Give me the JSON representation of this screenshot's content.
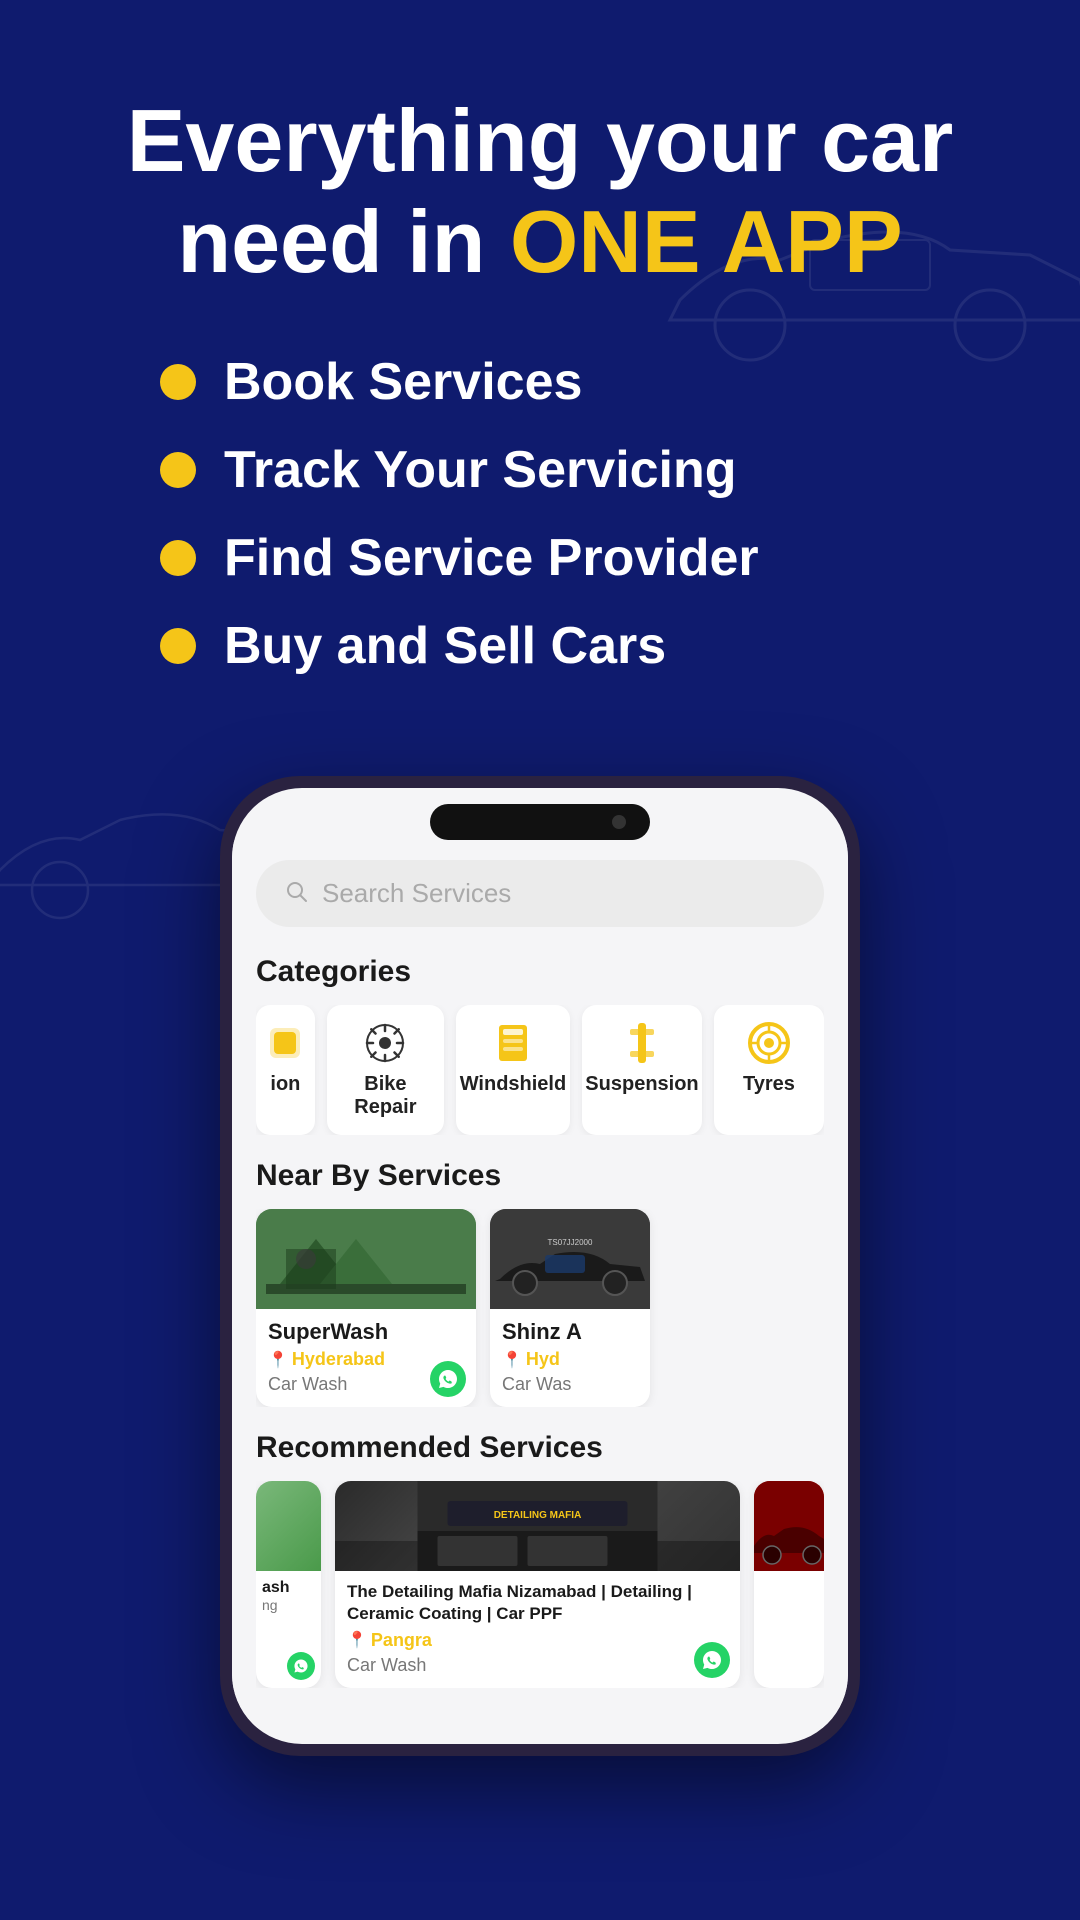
{
  "background_color": "#0f1b6e",
  "header": {
    "title_line1": "Everything your car",
    "title_line2": "need in ",
    "title_highlight": "ONE APP"
  },
  "bullet_points": [
    {
      "id": "book",
      "text": "Book Services"
    },
    {
      "id": "track",
      "text": "Track Your Servicing"
    },
    {
      "id": "find",
      "text": "Find Service Provider"
    },
    {
      "id": "buy",
      "text": "Buy and Sell Cars"
    }
  ],
  "search": {
    "placeholder": "Search Services"
  },
  "categories_section": {
    "title": "Categories",
    "items": [
      {
        "id": "partial",
        "label": "ion",
        "icon": "partial"
      },
      {
        "id": "bike-repair",
        "label": "Bike Repair",
        "icon": "gear"
      },
      {
        "id": "windshield",
        "label": "Windshield",
        "icon": "windshield"
      },
      {
        "id": "suspension",
        "label": "Suspension",
        "icon": "suspension"
      },
      {
        "id": "tyres",
        "label": "Tyres",
        "icon": "tyre"
      }
    ]
  },
  "nearby_section": {
    "title": "Near By Services",
    "items": [
      {
        "id": "superwash",
        "name": "SuperWash",
        "location": "Hyderabad",
        "type": "Car Wash",
        "image_type": "green-tent"
      },
      {
        "id": "shinz",
        "name": "Shinz A",
        "location": "Hyd",
        "type": "Car Was",
        "image_type": "bmw-car"
      }
    ]
  },
  "recommended_section": {
    "title": "Recommended Services",
    "items": [
      {
        "id": "partial-left",
        "name": "ash",
        "sub": "ng",
        "image_type": "partial-left"
      },
      {
        "id": "detailing-mafia",
        "name": "The Detailing Mafia Nizamabad | Detailing | Ceramic Coating | Car PPF",
        "location": "Pangra",
        "type": "Car Wash",
        "image_type": "detailing"
      },
      {
        "id": "red-partial",
        "name": "",
        "image_type": "red-car"
      }
    ]
  },
  "colors": {
    "primary_bg": "#0f1b6e",
    "highlight": "#f5c518",
    "white": "#ffffff",
    "card_bg": "#ffffff",
    "search_bg": "#ebebeb",
    "text_primary": "#1a1a1a",
    "text_secondary": "#777777",
    "location_color": "#f5c518",
    "whatsapp_green": "#25d366"
  },
  "icons": {
    "search": "🔍",
    "location_pin": "📍",
    "whatsapp": "W",
    "gear": "⚙",
    "windshield": "🔧",
    "tyre": "⭕",
    "suspension": "📱"
  }
}
